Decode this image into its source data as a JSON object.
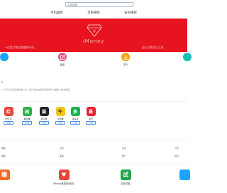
{
  "search": {
    "placeholder": "应用搜索"
  },
  "tabs": [
    "手机兼职",
    "苹果赚钱",
    "安卓赚钱"
  ],
  "banner": {
    "brand": "iMoney",
    "slogan_left": "一会官方钱包找赚钱平台，",
    "slogan_right": "加入方我全日之宣..."
  },
  "quick": [
    {
      "label": "",
      "color": "#1aa3ff"
    },
    {
      "label": "最新",
      "color": "#f04e7c"
    },
    {
      "label": "排行",
      "color": "#f7a21b"
    },
    {
      "label": "",
      "color": "#1ac0b5"
    }
  ],
  "section": {
    "title": "P",
    "desc": "一个专业手机应用的推介站，用户通过这些应用软件可以赚取一些零钱等。"
  },
  "apps": [
    {
      "name": "PP红包",
      "button": "注册",
      "color": "#e8443a",
      "glyph": "红"
    },
    {
      "name": "趣闲赚",
      "button": "注册",
      "color": "#2db24a",
      "glyph": "闲"
    },
    {
      "name": "悬赏猫",
      "button": "注册",
      "color": "#222222",
      "glyph": "猫"
    },
    {
      "name": "牛帮赚",
      "button": "注册",
      "color": "#f5c518",
      "glyph": "牛"
    },
    {
      "name": "多得试",
      "button": "注册",
      "color": "#1ab34e",
      "glyph": "多"
    },
    {
      "name": "悬赏",
      "button": "注册",
      "color": "#e8232f",
      "glyph": "悬"
    }
  ],
  "grid": [
    [
      "赚钱",
      "全新",
      "资源",
      "分享"
    ],
    [
      "赚钱",
      "兼职",
      "推广",
      "钱包"
    ]
  ],
  "bottom": [
    {
      "name": "",
      "color": "#f26a22",
      "glyph": "赚"
    },
    {
      "name": "iMoney爱盈利(官网)",
      "color": "#e8443a",
      "glyph": "♥"
    },
    {
      "name": "应用试客",
      "color": "#21a346",
      "glyph": "试"
    },
    {
      "name": "",
      "color": "#1aa3ff",
      "glyph": ""
    }
  ]
}
